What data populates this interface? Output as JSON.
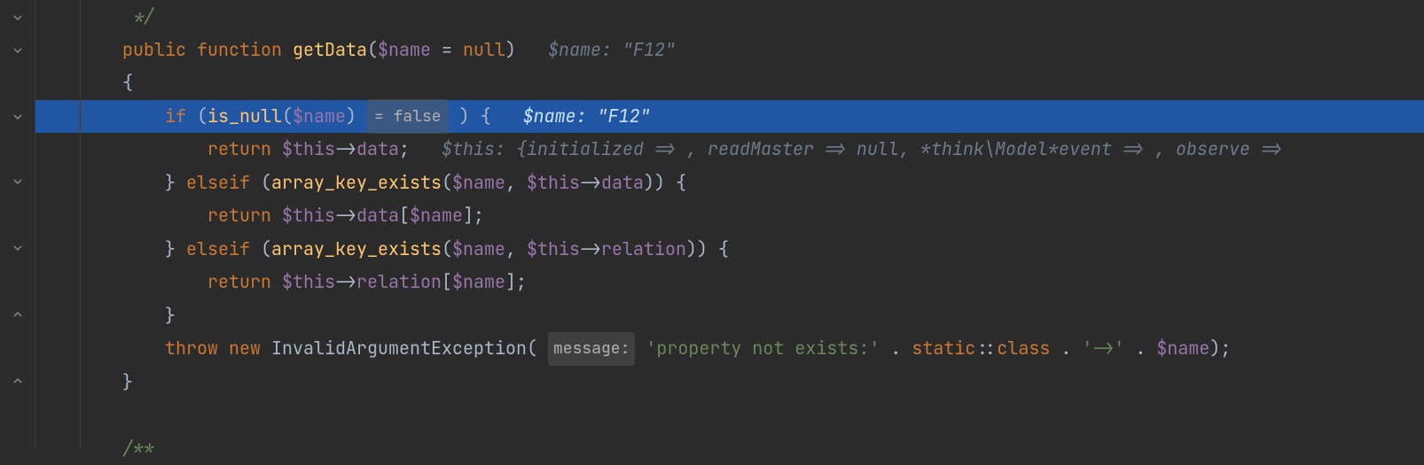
{
  "lines": {
    "l0_comment_end": "*/",
    "l1_public": "public",
    "l1_function": "function",
    "l1_funcname": "getData",
    "l1_open": "(",
    "l1_var": "$name",
    "l1_eq": " = ",
    "l1_null": "null",
    "l1_close": ")",
    "l1_hint": "$name: \"F12\"",
    "l2_brace": "{",
    "l3_if": "if",
    "l3_open": " (",
    "l3_isnull": "is_null",
    "l3_p1": "(",
    "l3_var": "$name",
    "l3_p2": ")",
    "l3_inlay": "= false",
    "l3_after": ") {",
    "l3_hint": "$name: \"F12\"",
    "l4_return": "return",
    "l4_this": " $this",
    "l4_arrow": "->",
    "l4_data": "data",
    "l4_semi": ";",
    "l4_hint": "$this: {initialized => , readMaster => null, *think\\Model*event => , observe =>",
    "l5_close": "}",
    "l5_elseif": " elseif ",
    "l5_p1": "(",
    "l5_ake": "array_key_exists",
    "l5_args_open": "(",
    "l5_name": "$name",
    "l5_comma": ", ",
    "l5_this": "$this",
    "l5_arrow": "->",
    "l5_data": "data",
    "l5_args_close": "))",
    "l5_brace": " {",
    "l6_return": "return",
    "l6_this": " $this",
    "l6_arrow": "->",
    "l6_data": "data",
    "l6_br1": "[",
    "l6_name": "$name",
    "l6_br2": "];",
    "l7_close": "}",
    "l7_elseif": " elseif ",
    "l7_p1": "(",
    "l7_ake": "array_key_exists",
    "l7_args_open": "(",
    "l7_name": "$name",
    "l7_comma": ", ",
    "l7_this": "$this",
    "l7_arrow": "->",
    "l7_rel": "relation",
    "l7_args_close": "))",
    "l7_brace": " {",
    "l8_return": "return",
    "l8_this": " $this",
    "l8_arrow": "->",
    "l8_rel": "relation",
    "l8_br1": "[",
    "l8_name": "$name",
    "l8_br2": "];",
    "l9_close": "}",
    "l10_throw": "throw",
    "l10_new": " new ",
    "l10_exc": "InvalidArgumentException",
    "l10_p1": "(",
    "l10_inlay": "message:",
    "l10_str1": "'property not exists:'",
    "l10_dot1": " . ",
    "l10_static": "static",
    "l10_coloncolon": "::",
    "l10_class": "class",
    "l10_dot2": " . ",
    "l10_str2": "'->'",
    "l10_dot3": " . ",
    "l10_name": "$name",
    "l10_p2": ");",
    "l11_close": "}",
    "l13_doc": "/**"
  }
}
